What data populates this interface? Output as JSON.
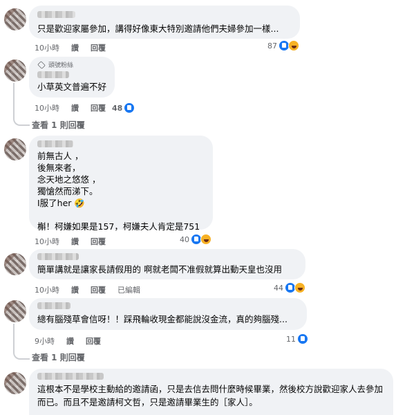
{
  "comments": [
    {
      "text": "只是歡迎家屬參加，講得好像東大特別邀請他們夫婦參加一樣...",
      "time": "10小時",
      "like": "讚",
      "reply": "回覆",
      "count": "87"
    },
    {
      "badge": "頭號粉絲",
      "text": "小草英文普遍不好",
      "time": "10小時",
      "like": "讚",
      "reply": "回覆",
      "count": "48",
      "view_replies": "查看 1 則回覆"
    },
    {
      "text": "前無古人 ，\n後無來者，\n念天地之悠悠 ，\n獨愴然而涕下。\nI服了her 🤣\n\n槲！柯嫌如果是157，柯嫌夫人肯定是751",
      "time": "10小時",
      "like": "讚",
      "reply": "回覆",
      "count": "40"
    },
    {
      "text": "簡單講就是讓家長請假用的 啊就老闆不准假就算出動天皇也沒用",
      "time": "10小時",
      "like": "讚",
      "reply": "回覆",
      "edited": "已編輯",
      "count": "44"
    },
    {
      "text": "總有腦殘草會信呀！！踩飛輪收現金都能說沒金流，真的夠腦殘...",
      "time": "9小時",
      "like": "讚",
      "reply": "回覆",
      "count": "11",
      "view_replies": "查看 1 則回覆"
    },
    {
      "text": "這根本不是學校主動給的邀請函，只是去信去問什麼時候畢業，然後校方說歡迎家人去參加而已。而且不是邀請柯文哲，只是邀請畢業生的［家人］。"
    }
  ],
  "icons": [
    "like-icon",
    "haha-icon",
    "fan-badge-icon"
  ],
  "colors": {
    "bubble": "#f0f2f5",
    "meta": "#65676b",
    "like": "#1877f2",
    "haha": "#f7b125"
  }
}
